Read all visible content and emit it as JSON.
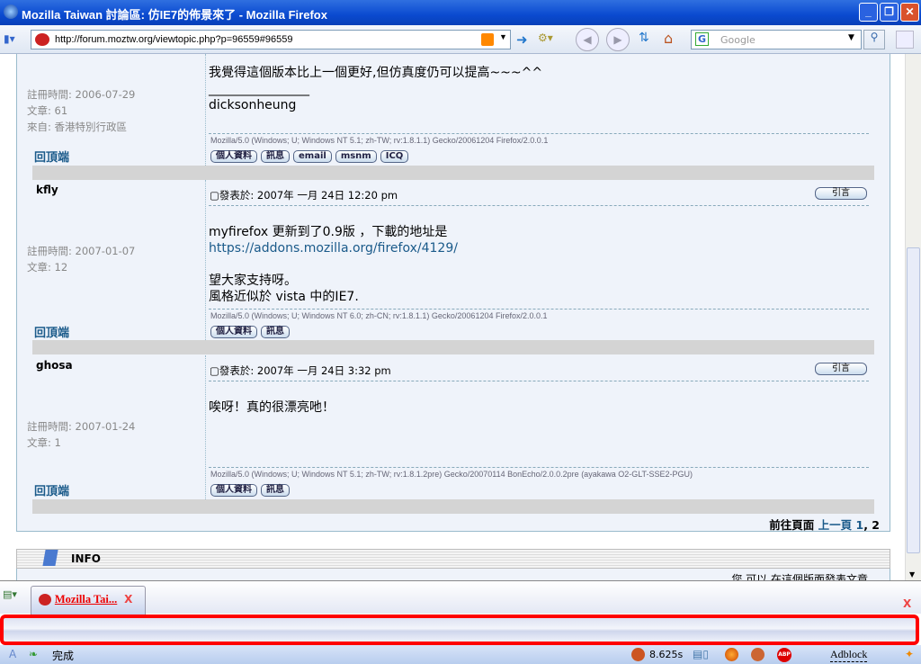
{
  "window": {
    "title": "Mozilla Taiwan 討論區: 仿IE7的佈景來了 - Mozilla Firefox"
  },
  "toolbar": {
    "url": "http://forum.moztw.org/viewtopic.php?p=96559#96559",
    "search_placeholder": "Google",
    "search_engine_letter": "G"
  },
  "posts": [
    {
      "author": "",
      "reg": "註冊時間: 2006-07-29",
      "count": "文章: 61",
      "from": "來自: 香港特別行政區",
      "body": [
        "我覺得這個版本比上一個更好,但仿真度仍可以提高~~~^^",
        "________________",
        "dicksonheung"
      ],
      "ua": "Mozilla/5.0 (Windows; U; Windows NT 5.1; zh-TW; rv:1.8.1.1) Gecko/20061204 Firefox/2.0.0.1",
      "buttons": [
        "個人資料",
        "訊息",
        "email",
        "msnm",
        "ICQ"
      ]
    },
    {
      "author": "kfly",
      "posted": "發表於: 2007年 一月 24日 12:20 pm",
      "reg": "註冊時間: 2007-01-07",
      "count": "文章: 12",
      "body_1": "myfirefox 更新到了0.9版 ，下載的地址是",
      "link": "https://addons.mozilla.org/firefox/4129/",
      "body_2": "望大家支持呀。",
      "body_3": "風格近似於 vista 中的IE7.",
      "ua": "Mozilla/5.0 (Windows; U; Windows NT 6.0; zh-CN; rv:1.8.1.1) Gecko/20061204 Firefox/2.0.0.1",
      "buttons": [
        "個人資料",
        "訊息"
      ]
    },
    {
      "author": "ghosa",
      "posted": "發表於: 2007年 一月 24日 3:32 pm",
      "reg": "註冊時間: 2007-01-24",
      "count": "文章: 1",
      "body": "唉呀！真的很漂亮吔！",
      "ua": "Mozilla/5.0 (Windows; U; Windows NT 5.1; zh-TW; rv:1.8.1.2pre) Gecko/20070114 BonEcho/2.0.0.2pre (ayakawa O2-GLT-SSE2-PGU)",
      "buttons": [
        "個人資料",
        "訊息"
      ]
    }
  ],
  "labels": {
    "back_to_top": "回頂端",
    "quote": "引言"
  },
  "pagination": {
    "label": "前往頁面",
    "prev": "上一頁",
    "pages": [
      "1",
      "2"
    ],
    "sep": ", "
  },
  "info": {
    "title": "INFO",
    "text": "您 可以 在這個版面發表文章"
  },
  "tabs": [
    {
      "label": "Mozilla Tai...",
      "close": "X"
    }
  ],
  "tabbar_close": "X",
  "status": {
    "text": "完成",
    "time": "8.625s",
    "adblock": "Adblock",
    "abp": "ABP"
  }
}
